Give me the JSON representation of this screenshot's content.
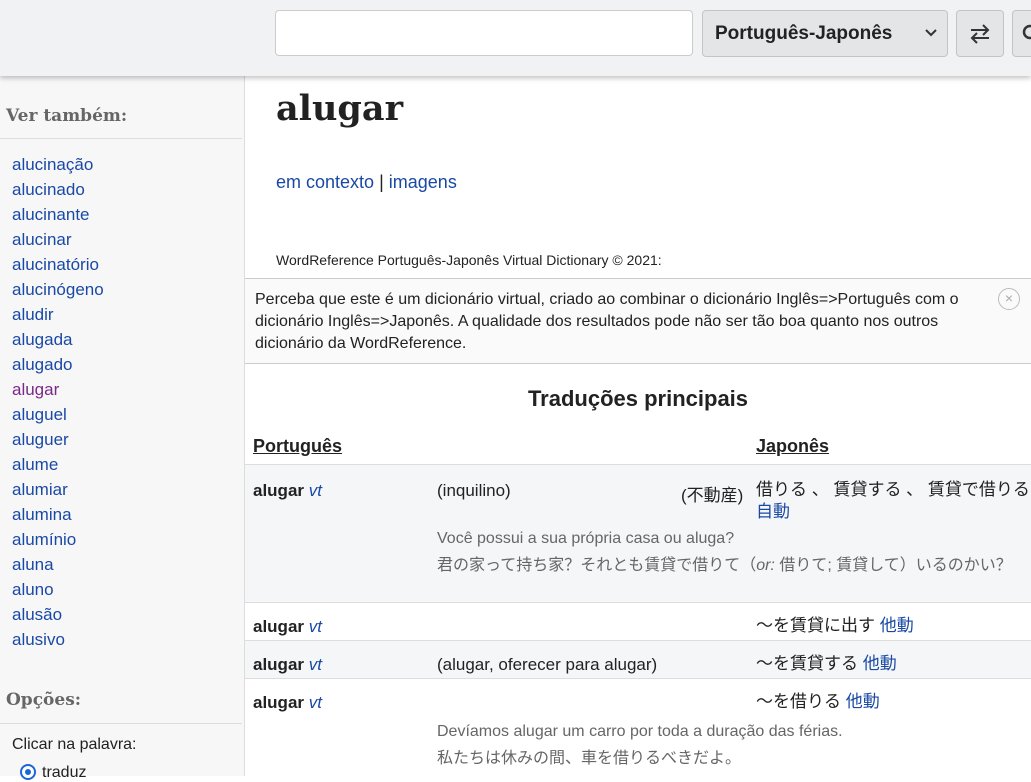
{
  "header": {
    "search_value": "",
    "language": "Português-Japonês",
    "swap_icon": "swap-arrows-icon",
    "search_icon": "magnifier-icon"
  },
  "sidebar": {
    "see_also_heading": "Ver também:",
    "see_also": [
      "alucinação",
      "alucinado",
      "alucinante",
      "alucinar",
      "alucinatório",
      "alucinógeno",
      "aludir",
      "alugada",
      "alugado",
      "alugar",
      "aluguel",
      "aluguer",
      "alume",
      "alumiar",
      "alumina",
      "alumínio",
      "aluna",
      "aluno",
      "alusão",
      "alusivo"
    ],
    "options_heading": "Opções:",
    "click_word_label": "Clicar na palavra:",
    "radio_label": "traduz"
  },
  "main": {
    "headword": "alugar",
    "links": {
      "context": "em contexto",
      "separator": "|",
      "images": "imagens"
    },
    "copyright": "WordReference Português-Japonês Virtual Dictionary © 2021:",
    "notice": "Perceba que este é um dicionário virtual, criado ao combinar o dicionário Inglês=>Português com o dicionário Inglês=>Japonês. A qualidade dos resultados pode não ser tão boa quanto nos outros dicionário da WordReference.",
    "close_symbol": "×",
    "section_title": "Traduções principais",
    "col_source": "Português",
    "col_target": "Japonês",
    "rows": [
      {
        "word": "alugar",
        "pos": "vt",
        "context": "(inquilino)",
        "note": "(不動産)",
        "translation": "借りる 、 賃貸する 、 賃貸で借りる",
        "tpos": "自動",
        "example_pt": "Você possui a sua própria casa ou aluga?",
        "example_jp_1": "君の家って持ち家？それとも賃貸で借りて（",
        "example_jp_or": "or:",
        "example_jp_2": " 借りて; 賃貸して）いるのかい？"
      },
      {
        "word": "alugar",
        "pos": "vt",
        "context": "",
        "translation": "～を賃貸に出す",
        "tpos": "他動"
      },
      {
        "word": "alugar",
        "pos": "vt",
        "context": "(alugar, oferecer para alugar)",
        "translation": "～を賃貸する",
        "tpos": "他動"
      },
      {
        "word": "alugar",
        "pos": "vt",
        "context": "",
        "translation": "～を借りる",
        "tpos": "他動",
        "example_pt": "Devíamos alugar um carro por toda a duração das férias.",
        "example_jp": "私たちは休みの間、車を借りるべきだよ。"
      }
    ]
  }
}
